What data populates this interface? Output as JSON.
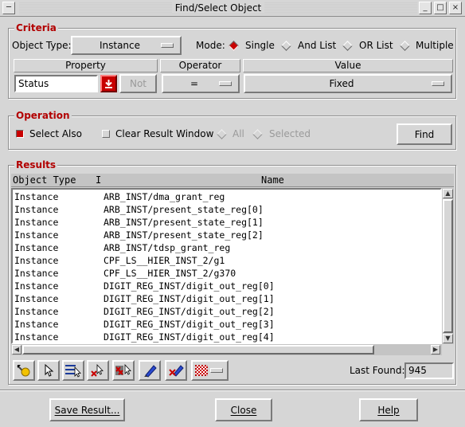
{
  "window": {
    "title": "Find/Select Object",
    "buttons": {
      "minimize": "_",
      "maximize": "□",
      "close": "×"
    }
  },
  "criteria": {
    "legend": "Criteria",
    "object_type_label": "Object Type:",
    "object_type_value": "Instance",
    "mode_label": "Mode:",
    "modes": [
      "Single",
      "And List",
      "OR List",
      "Multiple"
    ],
    "mode_selected": "Single",
    "headers": {
      "property": "Property",
      "operator": "Operator",
      "value": "Value"
    },
    "property_value": "Status",
    "not_label": "Not",
    "operator_value": "=",
    "value_value": "Fixed"
  },
  "operation": {
    "legend": "Operation",
    "select_also_label": "Select Also",
    "select_also_checked": true,
    "clear_result_label": "Clear Result Window",
    "clear_result_checked": false,
    "all_label": "All",
    "selected_label": "Selected",
    "find_label": "Find"
  },
  "results": {
    "legend": "Results",
    "columns": [
      "Object Type",
      "I",
      "Name"
    ],
    "rows": [
      [
        "Instance",
        "ARB_INST/dma_grant_reg"
      ],
      [
        "Instance",
        "ARB_INST/present_state_reg[0]"
      ],
      [
        "Instance",
        "ARB_INST/present_state_reg[1]"
      ],
      [
        "Instance",
        "ARB_INST/present_state_reg[2]"
      ],
      [
        "Instance",
        "ARB_INST/tdsp_grant_reg"
      ],
      [
        "Instance",
        "CPF_LS__HIER_INST_2/g1"
      ],
      [
        "Instance",
        "CPF_LS__HIER_INST_2/g370"
      ],
      [
        "Instance",
        "DIGIT_REG_INST/digit_out_reg[0]"
      ],
      [
        "Instance",
        "DIGIT_REG_INST/digit_out_reg[1]"
      ],
      [
        "Instance",
        "DIGIT_REG_INST/digit_out_reg[2]"
      ],
      [
        "Instance",
        "DIGIT_REG_INST/digit_out_reg[3]"
      ],
      [
        "Instance",
        "DIGIT_REG_INST/digit_out_reg[4]"
      ]
    ],
    "last_found_label": "Last Found:",
    "last_found_value": "945"
  },
  "toolbar_icons": [
    "highlight-icon",
    "select-pointer-icon",
    "select-list-icon",
    "deselect-icon",
    "deselect-all-icon",
    "highlight-pen-icon",
    "dehighlight-pen-icon",
    "color-pattern-icon"
  ],
  "footer": {
    "save_result": "Save Result...",
    "close": "Close",
    "help": "Help"
  },
  "colors": {
    "accent_red": "#c80000",
    "legend_red": "#b20000",
    "background": "#d6d6d6"
  }
}
